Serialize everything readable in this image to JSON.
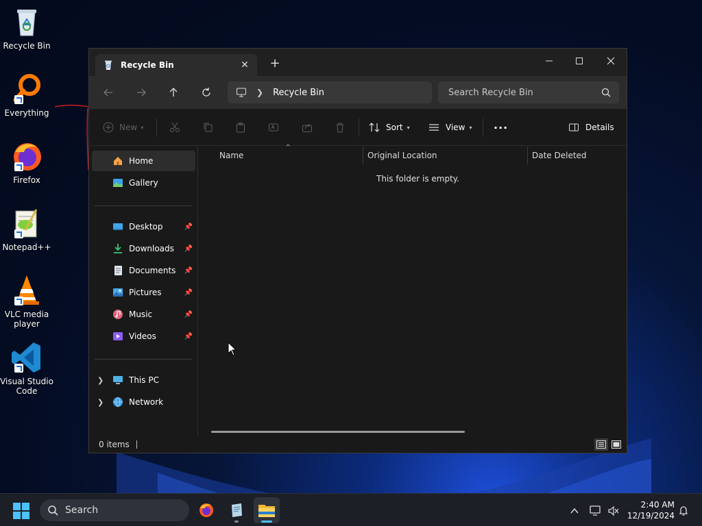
{
  "desktop": {
    "icons": [
      {
        "label": "Recycle Bin"
      },
      {
        "label": "Everything"
      },
      {
        "label": "Firefox"
      },
      {
        "label": "Notepad++"
      },
      {
        "label": "VLC media player"
      },
      {
        "label": "Visual Studio Code"
      }
    ]
  },
  "window": {
    "tab_title": "Recycle Bin",
    "address": {
      "crumb": "Recycle Bin"
    },
    "search": {
      "placeholder": "Search Recycle Bin"
    },
    "toolbar": {
      "new_label": "New",
      "sort_label": "Sort",
      "view_label": "View",
      "details_label": "Details"
    },
    "nav": {
      "home": "Home",
      "gallery": "Gallery",
      "desktop": "Desktop",
      "downloads": "Downloads",
      "documents": "Documents",
      "pictures": "Pictures",
      "music": "Music",
      "videos": "Videos",
      "this_pc": "This PC",
      "network": "Network"
    },
    "columns": {
      "name": "Name",
      "original_location": "Original Location",
      "date_deleted": "Date Deleted"
    },
    "empty_message": "This folder is empty.",
    "status": {
      "item_count": "0 items"
    }
  },
  "taskbar": {
    "search_label": "Search",
    "clock": {
      "time": "2:40 AM",
      "date": "12/19/2024"
    }
  },
  "colors": {
    "accent": "#4cc2ff",
    "window_bg": "#191919",
    "titlebar_bg": "#202020",
    "navbar_bg": "#2c2c2c"
  }
}
